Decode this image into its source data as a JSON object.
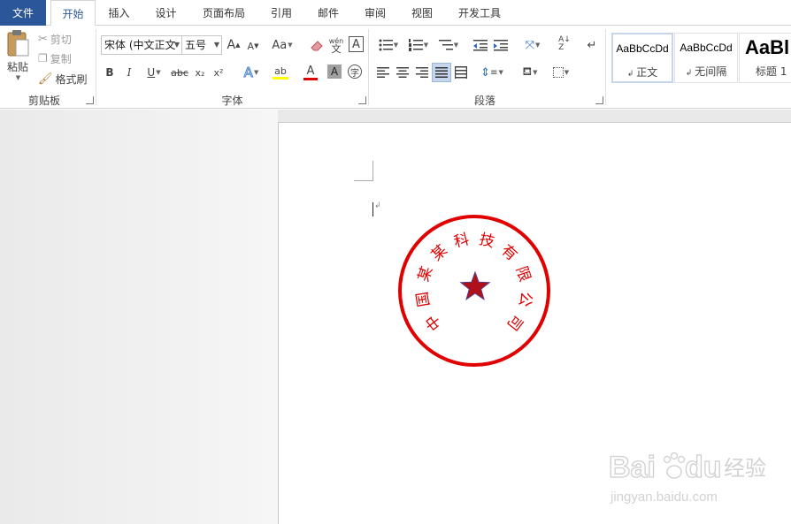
{
  "tabs": {
    "file": "文件",
    "home": "开始",
    "insert": "插入",
    "design": "设计",
    "layout": "页面布局",
    "references": "引用",
    "mailings": "邮件",
    "review": "审阅",
    "view": "视图",
    "developer": "开发工具"
  },
  "clipboard": {
    "paste": "粘贴",
    "cut": "剪切",
    "copy": "复制",
    "format_painter": "格式刷",
    "group": "剪贴板"
  },
  "font": {
    "name": "宋体 (中文正文",
    "size": "五号",
    "group": "字体",
    "bold": "B",
    "italic": "I",
    "underline": "U",
    "strike": "abc",
    "subscript": "x₂",
    "superscript": "x²",
    "grow": "A",
    "shrink": "A",
    "change_case": "Aa",
    "phonetic": "wén",
    "phonetic_char": "文",
    "highlight_color": "#ffff00",
    "font_color": "#e00000",
    "enclose_char": "字"
  },
  "paragraph": {
    "group": "段落"
  },
  "styles": {
    "items": [
      {
        "preview": "AaBbCcDd",
        "name": "正文"
      },
      {
        "preview": "AaBbCcDd",
        "name": "无间隔"
      },
      {
        "preview": "AaBl",
        "name": "标题 1"
      }
    ],
    "selected_index": 0
  },
  "seal": {
    "text": "中国某某科技有限公司",
    "color": "#e00000",
    "star_color": "#b0101a",
    "star_outline": "#5a3a8a"
  },
  "watermark": {
    "brand": "Bai",
    "brand2": "du",
    "brand_cn": "经验",
    "url": "jingyan.baidu.com"
  },
  "colors": {
    "accent": "#2b579a",
    "paper": "#ffffff",
    "canvas": "#e9e9e9"
  }
}
